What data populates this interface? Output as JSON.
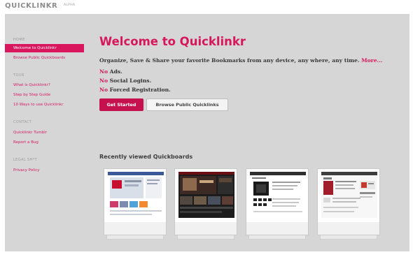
{
  "header": {
    "logo": "QUICKLINKR",
    "badge": "ALPHA"
  },
  "sidebar": {
    "sections": [
      {
        "title": "HOME",
        "items": [
          "Welcome to Quicklinkr",
          "Browse Public Quickboards"
        ]
      },
      {
        "title": "TOUR",
        "items": [
          "What is Quicklinkr?",
          "Step by Step Guide",
          "10 Ways to use Quicklinkr"
        ]
      },
      {
        "title": "CONTACT",
        "items": [
          "Quicklinkr Tumblr",
          "Report a Bug"
        ]
      },
      {
        "title": "LEGAL SH*T",
        "items": [
          "Privacy Policy"
        ]
      }
    ],
    "active": "Welcome to Quicklinkr"
  },
  "main": {
    "title": "Welcome to Quicklinkr",
    "tagline": "Organize, Save & Share your favorite Bookmarks from any device, any where, any time.",
    "more_link": "More...",
    "features": [
      {
        "no": "No",
        "text": "Ads."
      },
      {
        "no": "No",
        "text": "Social Logins."
      },
      {
        "no": "No",
        "text": "Forced Registration."
      }
    ],
    "get_started": "Get Started",
    "browse_public": "Browse Public Quicklinks",
    "recent_title": "Recently viewed Quickboards"
  },
  "colors": {
    "accent": "#d6175c",
    "panel_bg": "#d6d6d6",
    "button_primary": "#c5124f"
  }
}
